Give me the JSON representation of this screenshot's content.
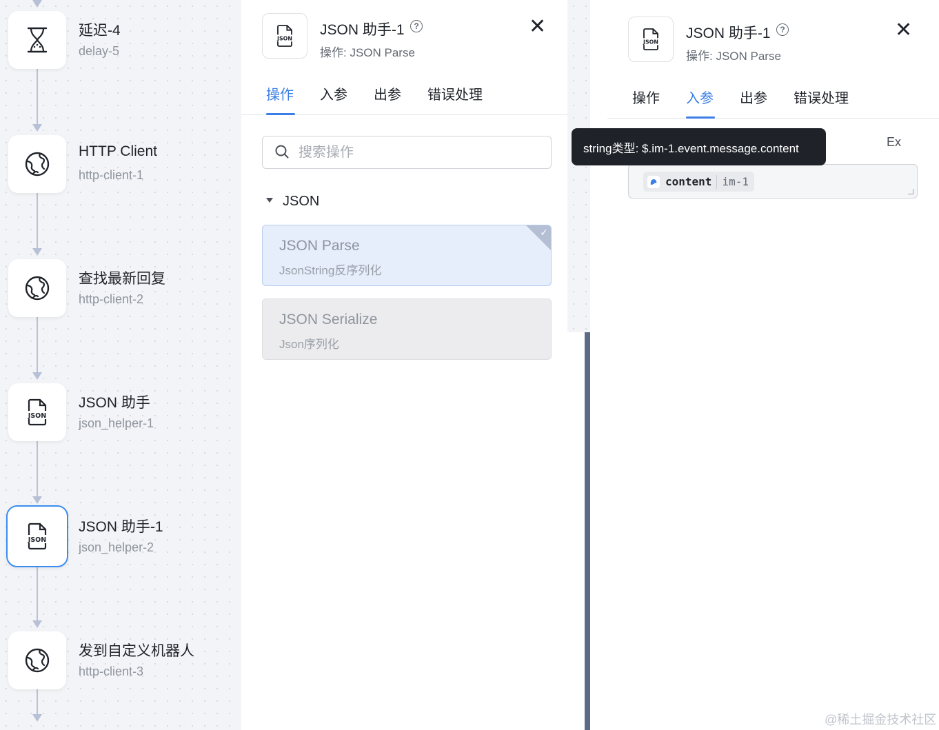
{
  "workflow": {
    "nodes": [
      {
        "title": "延迟-4",
        "subtitle": "delay-5",
        "icon": "hourglass-icon"
      },
      {
        "title": "HTTP Client",
        "subtitle": "http-client-1",
        "icon": "globe-icon"
      },
      {
        "title": "查找最新回复",
        "subtitle": "http-client-2",
        "icon": "globe-icon"
      },
      {
        "title": "JSON 助手",
        "subtitle": "json_helper-1",
        "icon": "json-file-icon"
      },
      {
        "title": "JSON 助手-1",
        "subtitle": "json_helper-2",
        "icon": "json-file-icon",
        "active": true
      },
      {
        "title": "发到自定义机器人",
        "subtitle": "http-client-3",
        "icon": "globe-icon"
      }
    ]
  },
  "mid_panel": {
    "title": "JSON 助手-1",
    "subtitle": "操作: JSON Parse",
    "icon_text": "JSON",
    "tabs": [
      "操作",
      "入参",
      "出参",
      "错误处理"
    ],
    "active_tab": "操作",
    "search_placeholder": "搜索操作",
    "group_label": "JSON",
    "operations": [
      {
        "title": "JSON Parse",
        "desc": "JsonString反序列化",
        "selected": true
      },
      {
        "title": "JSON Serialize",
        "desc": "Json序列化",
        "selected": false
      }
    ]
  },
  "right_panel": {
    "title": "JSON 助手-1",
    "subtitle": "操作: JSON Parse",
    "icon_text": "JSON",
    "tabs": [
      "操作",
      "入参",
      "出参",
      "错误处理"
    ],
    "active_tab": "入参",
    "tooltip": "string类型: $.im-1.event.message.content",
    "ex_label": "Ex",
    "chip": {
      "name": "content",
      "source": "im-1"
    }
  },
  "watermark": "@稀土掘金技术社区",
  "colors": {
    "accent": "#3b7ee6",
    "active_border": "#3b8df0",
    "connector": "#b8c0d8"
  }
}
